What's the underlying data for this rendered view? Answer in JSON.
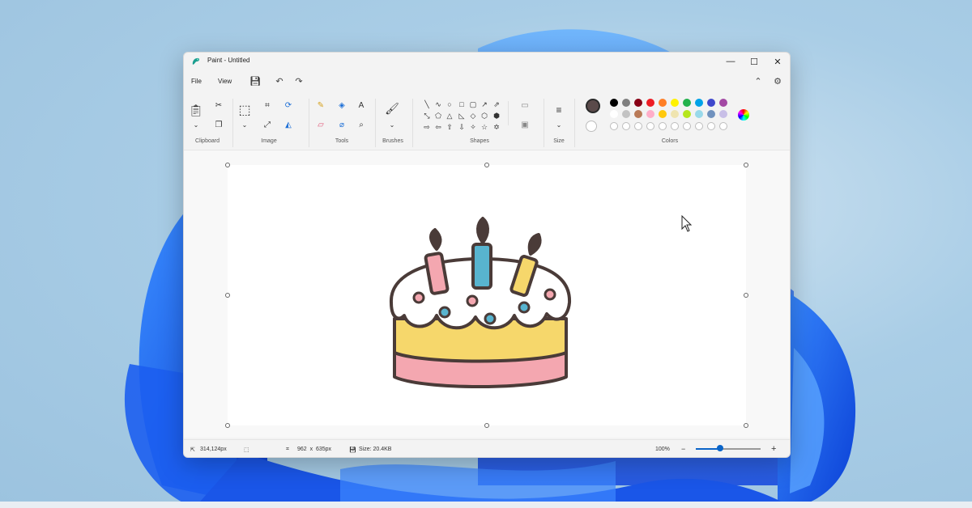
{
  "window": {
    "title": "Paint - Untitled"
  },
  "menu": {
    "file": "File",
    "view": "View"
  },
  "ribbon": {
    "groups": {
      "clipboard": "Clipboard",
      "image": "Image",
      "tools": "Tools",
      "brushes": "Brushes",
      "shapes": "Shapes",
      "size": "Size",
      "colors": "Colors"
    },
    "tools_letter": "A"
  },
  "colors": {
    "primary": "#5a4a4a",
    "secondary": "#ffffff",
    "palette_row1": [
      "#000000",
      "#7f7f7f",
      "#880015",
      "#ed1c24",
      "#ff7f27",
      "#fff200",
      "#22b14c",
      "#00a2e8",
      "#3f48cc",
      "#a349a4"
    ],
    "palette_row2": [
      "#ffffff",
      "#c3c3c3",
      "#b97a57",
      "#ffaec9",
      "#ffc90e",
      "#efe4b0",
      "#b5e61d",
      "#99d9ea",
      "#7092be",
      "#c8bfe7"
    ]
  },
  "drawing": {
    "cake_top": "#ffffff",
    "cake_middle": "#f6d76b",
    "cake_bottom": "#f4a7b0",
    "outline": "#4a3b38",
    "candles": [
      "#f4a7b0",
      "#58b4cf",
      "#f6d76b"
    ],
    "sprinkles": [
      "#f4a7b0",
      "#58b4cf"
    ]
  },
  "status": {
    "cursor_pos": "314,124px",
    "canvas_size": "962  x  635px",
    "file_size": "Size: 20.4KB",
    "zoom": "100%",
    "zoom_level": 0.38,
    "zoom_minus": "−",
    "zoom_plus": "+"
  }
}
